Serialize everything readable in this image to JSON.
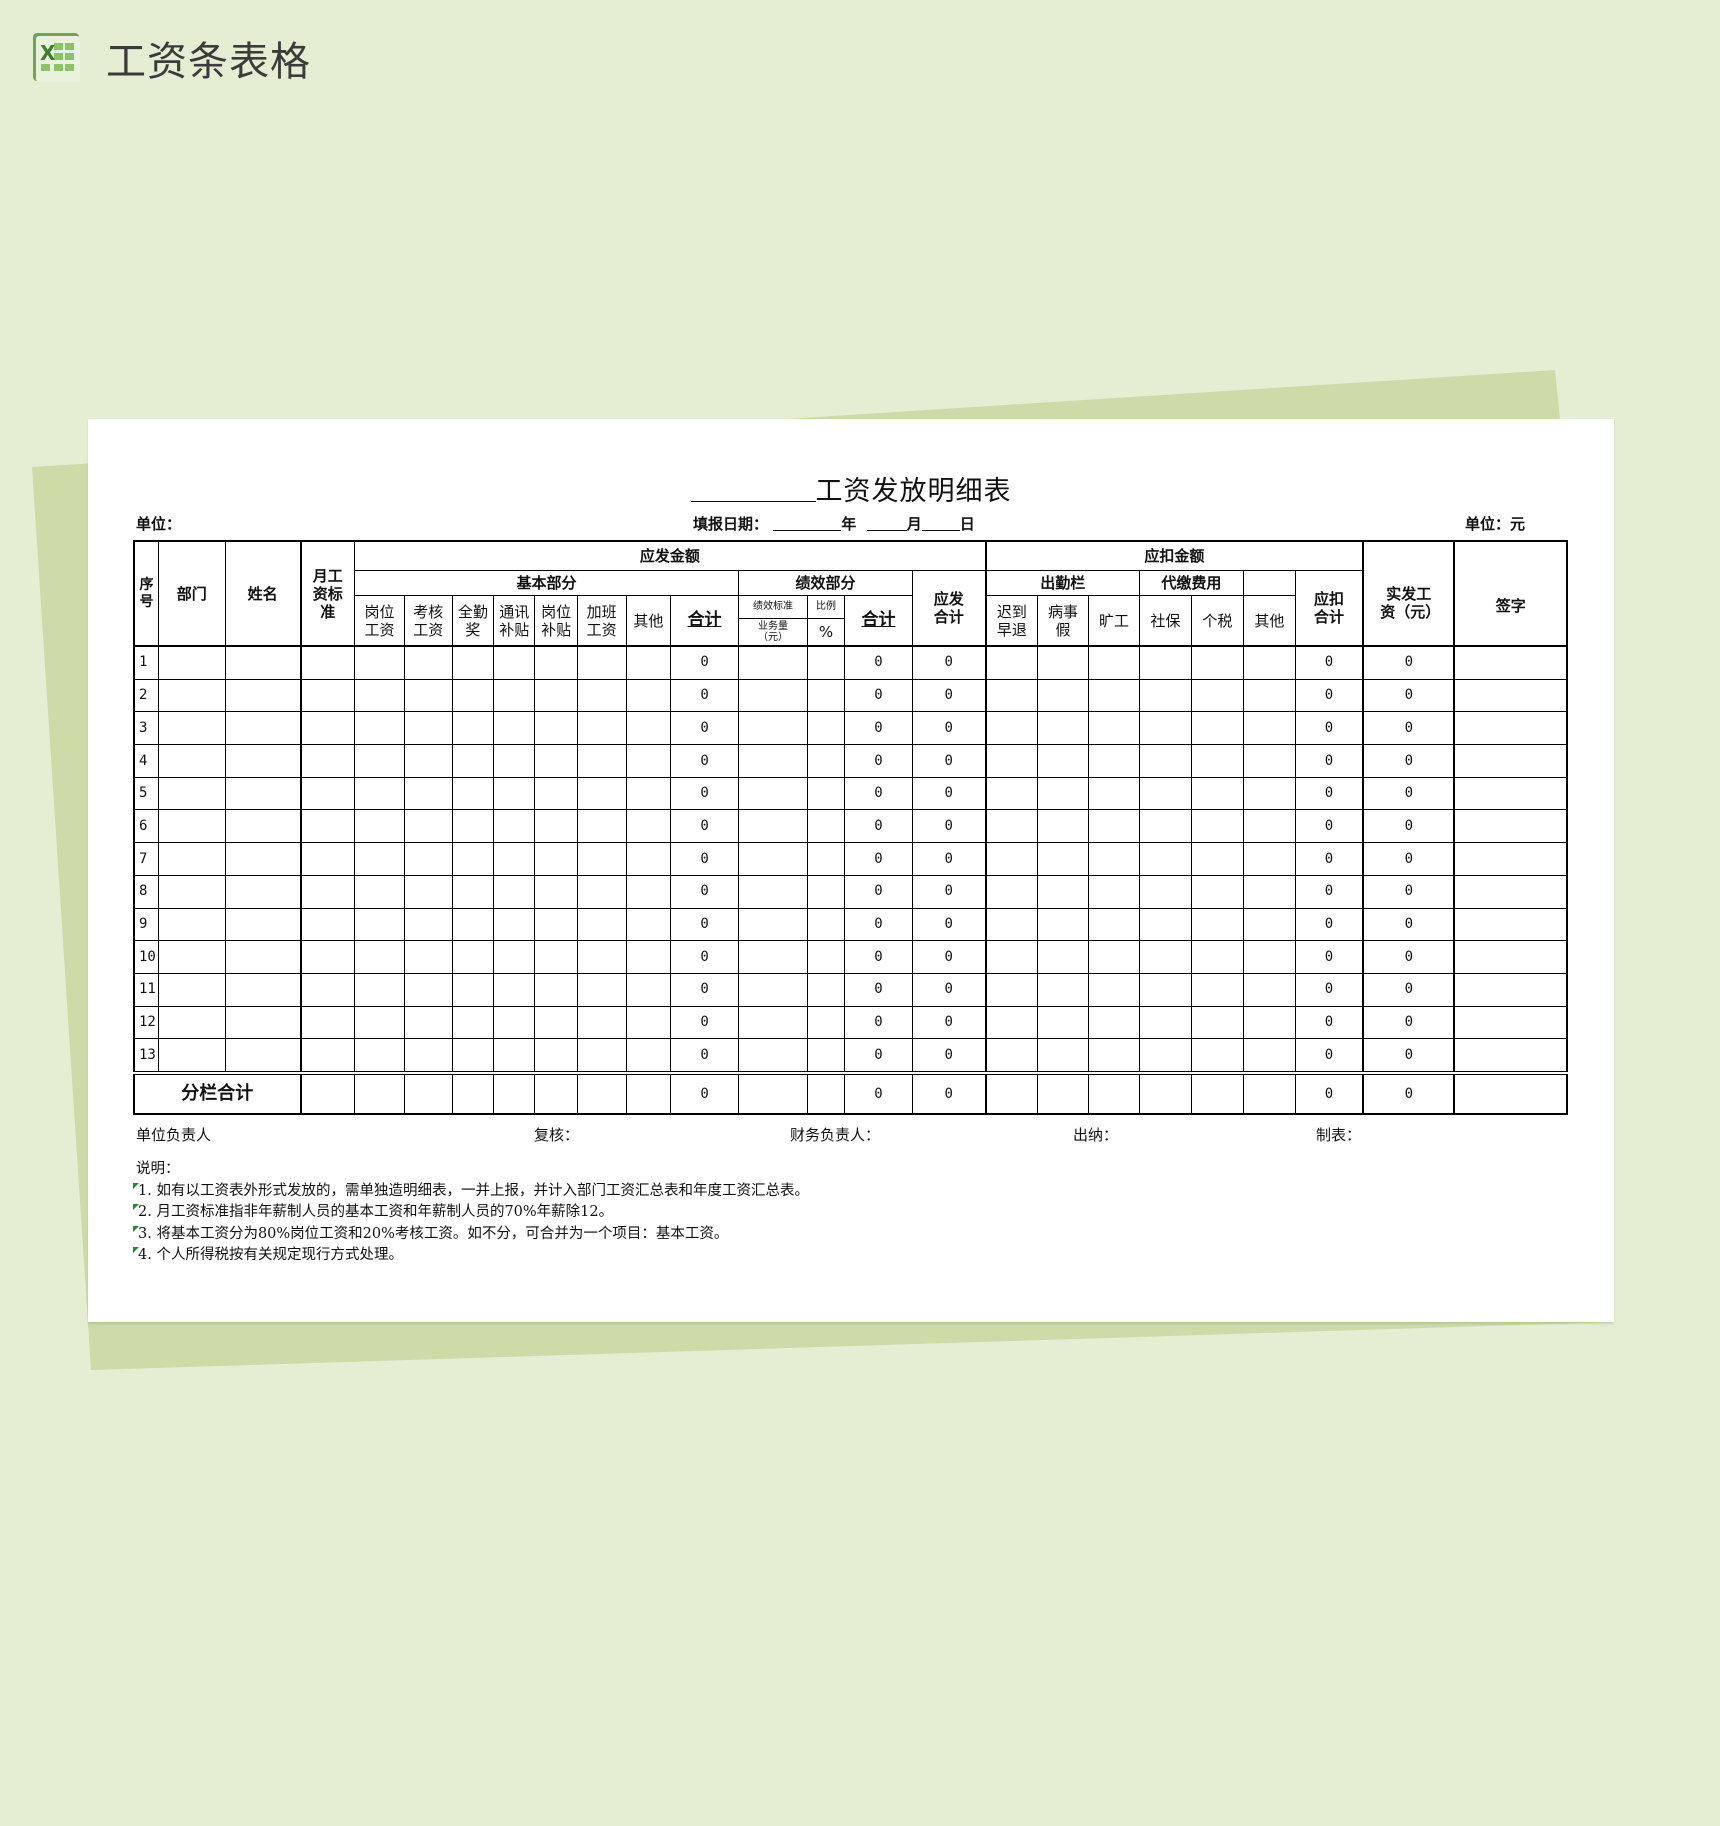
{
  "app": {
    "title": "工资条表格",
    "icon": "excel-icon"
  },
  "document": {
    "title_suffix": "工资发放明细表",
    "unit_label": "单位：",
    "fill_date_label": "填报日期：",
    "year_label": "年",
    "month_label": "月",
    "day_label": "日",
    "currency_unit": "单位：元"
  },
  "table": {
    "headers": {
      "seq": "序号",
      "dept": "部门",
      "name": "姓名",
      "monthly_standard": "月工资标准",
      "payable_group": "应发金额",
      "basic_part": "基本部分",
      "basic_cols": [
        "岗位工资",
        "考核工资",
        "全勤奖",
        "通讯补贴",
        "岗位补贴",
        "加班工资",
        "其他",
        "合计"
      ],
      "perf_part": "绩效部分",
      "perf_standard": "绩效标准",
      "perf_ratio": "比例",
      "perf_volume": "业务量（元）",
      "perf_percent": "%",
      "perf_total": "合计",
      "payable_total": "应发合计",
      "deduct_group": "应扣金额",
      "attendance": "出勤栏",
      "attendance_cols": [
        "迟到早退",
        "病事假",
        "旷工"
      ],
      "withholding": "代缴费用",
      "withholding_cols": [
        "社保",
        "个税"
      ],
      "deduct_other": "其他",
      "deduct_total": "应扣合计",
      "net_pay": "实发工资（元）",
      "signature": "签字"
    },
    "rows": [
      {
        "seq": "1",
        "basic_total": "0",
        "perf_total": "0",
        "payable_total": "0",
        "deduct_total": "0",
        "net_pay": "0"
      },
      {
        "seq": "2",
        "basic_total": "0",
        "perf_total": "0",
        "payable_total": "0",
        "deduct_total": "0",
        "net_pay": "0"
      },
      {
        "seq": "3",
        "basic_total": "0",
        "perf_total": "0",
        "payable_total": "0",
        "deduct_total": "0",
        "net_pay": "0"
      },
      {
        "seq": "4",
        "basic_total": "0",
        "perf_total": "0",
        "payable_total": "0",
        "deduct_total": "0",
        "net_pay": "0"
      },
      {
        "seq": "5",
        "basic_total": "0",
        "perf_total": "0",
        "payable_total": "0",
        "deduct_total": "0",
        "net_pay": "0"
      },
      {
        "seq": "6",
        "basic_total": "0",
        "perf_total": "0",
        "payable_total": "0",
        "deduct_total": "0",
        "net_pay": "0"
      },
      {
        "seq": "7",
        "basic_total": "0",
        "perf_total": "0",
        "payable_total": "0",
        "deduct_total": "0",
        "net_pay": "0"
      },
      {
        "seq": "8",
        "basic_total": "0",
        "perf_total": "0",
        "payable_total": "0",
        "deduct_total": "0",
        "net_pay": "0"
      },
      {
        "seq": "9",
        "basic_total": "0",
        "perf_total": "0",
        "payable_total": "0",
        "deduct_total": "0",
        "net_pay": "0"
      },
      {
        "seq": "10",
        "basic_total": "0",
        "perf_total": "0",
        "payable_total": "0",
        "deduct_total": "0",
        "net_pay": "0"
      },
      {
        "seq": "11",
        "basic_total": "0",
        "perf_total": "0",
        "payable_total": "0",
        "deduct_total": "0",
        "net_pay": "0"
      },
      {
        "seq": "12",
        "basic_total": "0",
        "perf_total": "0",
        "payable_total": "0",
        "deduct_total": "0",
        "net_pay": "0"
      },
      {
        "seq": "13",
        "basic_total": "0",
        "perf_total": "0",
        "payable_total": "0",
        "deduct_total": "0",
        "net_pay": "0"
      }
    ],
    "total_row": {
      "label": "分栏合计",
      "basic_total": "0",
      "perf_total": "0",
      "payable_total": "0",
      "deduct_total": "0",
      "net_pay": "0"
    }
  },
  "signatures": {
    "unit_head": "单位负责人",
    "reviewer": "复核：",
    "finance_head": "财务负责人：",
    "cashier": "出纳：",
    "preparer": "制表："
  },
  "notes": {
    "heading": "说明：",
    "items": [
      "1. 如有以工资表外形式发放的，需单独造明细表，一并上报，并计入部门工资汇总表和年度工资汇总表。",
      "2. 月工资标准指非年薪制人员的基本工资和年薪制人员的70%年薪除12。",
      "3. 将基本工资分为80%岗位工资和20%考核工资。如不分，可合并为一个项目：基本工资。",
      "4. 个人所得税按有关规定现行方式处理。"
    ]
  },
  "colors": {
    "background": "#e5eed3",
    "back_sheet": "#cddba9",
    "accent_green": "#1d8f2a"
  }
}
